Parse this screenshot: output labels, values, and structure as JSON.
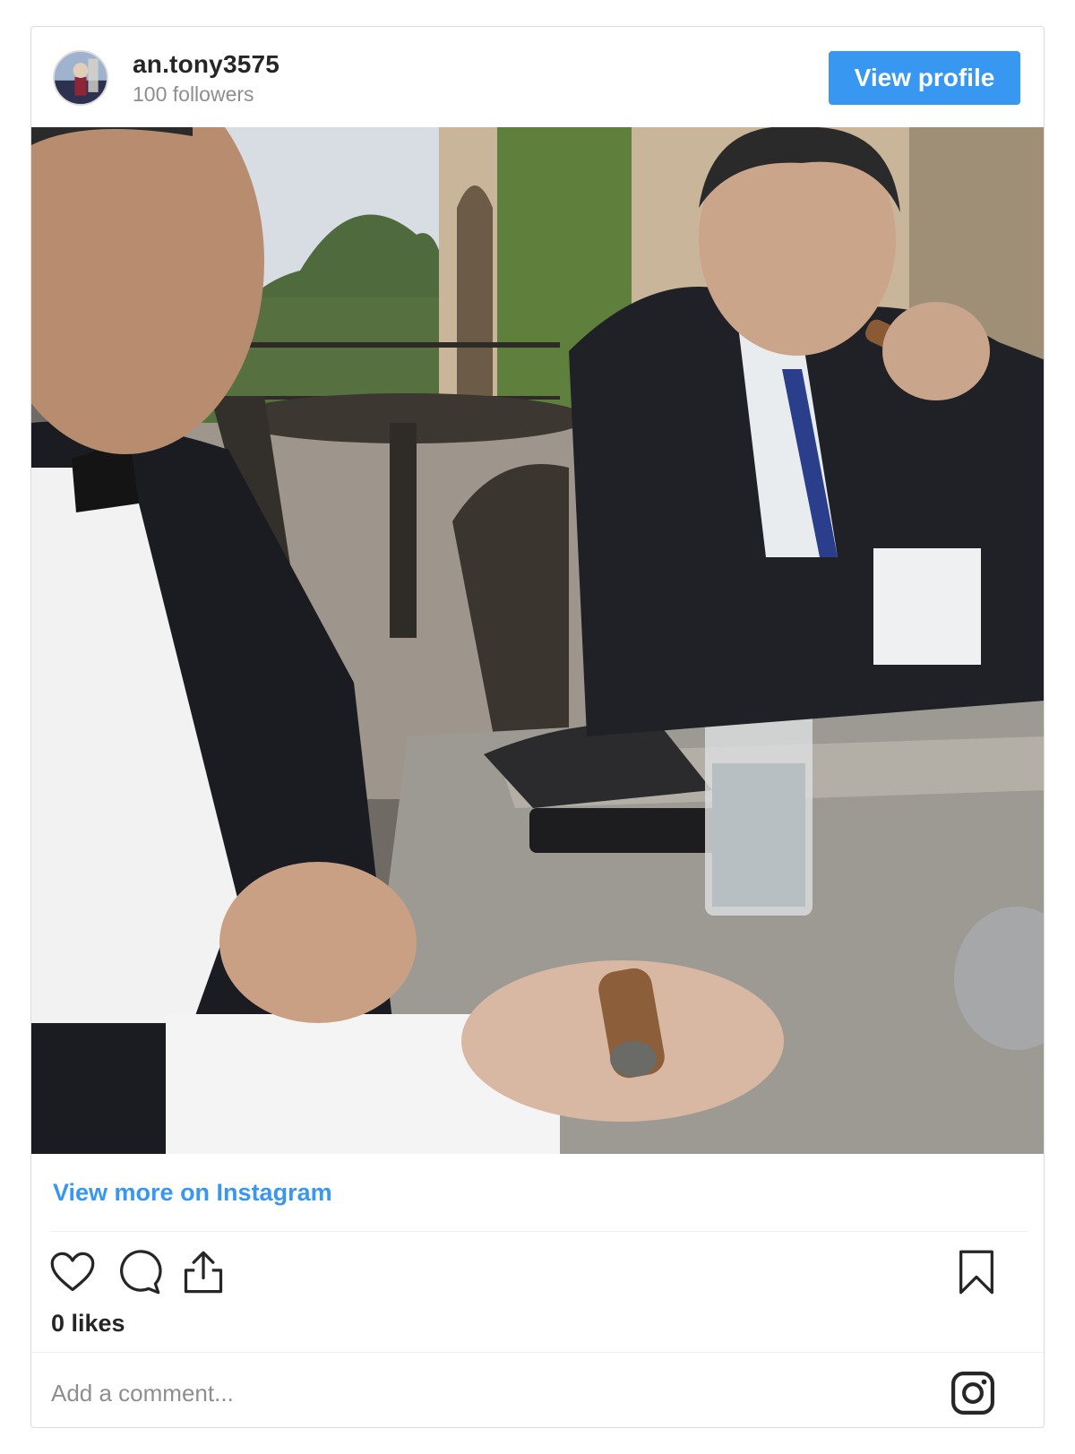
{
  "header": {
    "username": "an.tony3575",
    "followers": "100 followers",
    "view_profile_label": "View profile",
    "accent_color": "#3897f0"
  },
  "post": {
    "image_icon": "photo",
    "view_more_label": "View more on Instagram",
    "likes": "0 likes"
  },
  "actions": {
    "like_icon": "heart-icon",
    "comment_icon": "comment-icon",
    "share_icon": "share-icon",
    "save_icon": "bookmark-icon"
  },
  "comment": {
    "placeholder": "Add a comment...",
    "brand_icon": "instagram-icon"
  }
}
